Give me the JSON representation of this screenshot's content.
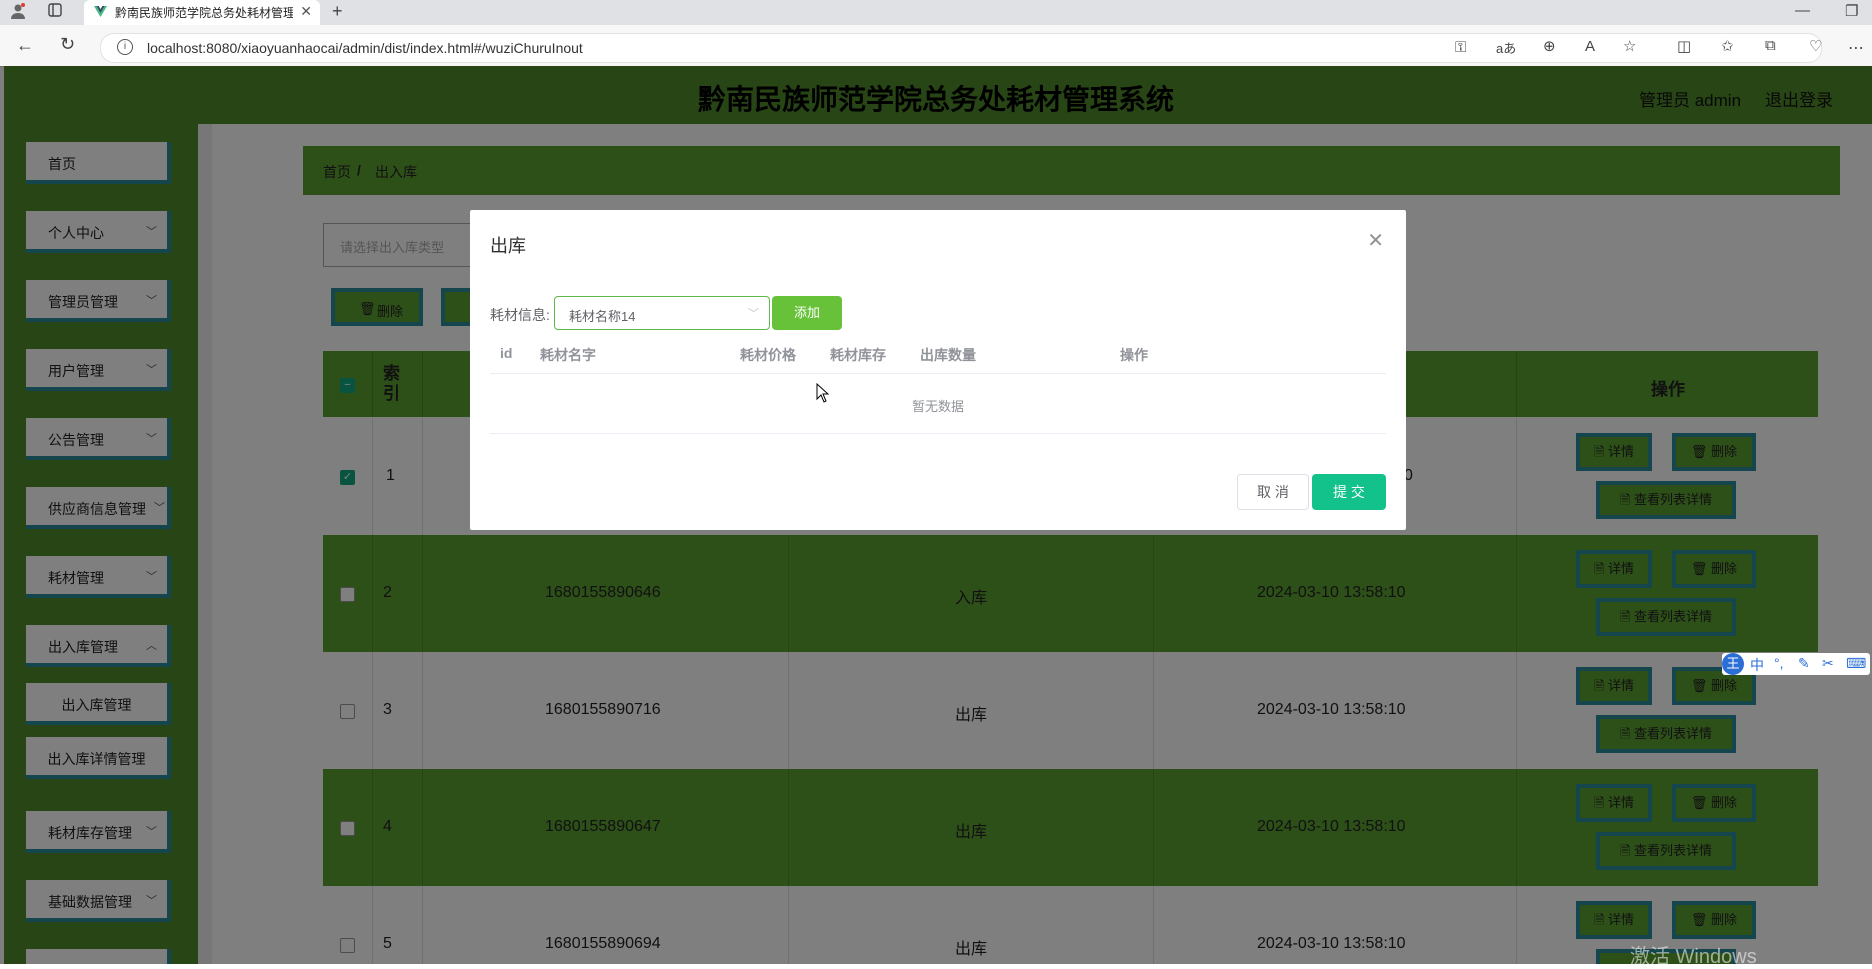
{
  "browser": {
    "tab_title": "黔南民族师范学院总务处耗材管理",
    "url": "localhost:8080/xiaoyuanhaocai/admin/dist/index.html#/wuziChuruInout"
  },
  "header": {
    "title": "黔南民族师范学院总务处耗材管理系统",
    "user": "管理员 admin",
    "logout": "退出登录"
  },
  "sidebar": {
    "items": [
      "首页",
      "个人中心",
      "管理员管理",
      "用户管理",
      "公告管理",
      "供应商信息管理",
      "耗材管理",
      "出入库管理",
      "耗材库存管理",
      "基础数据管理"
    ],
    "submenu": [
      "出入库管理",
      "出入库详情管理"
    ]
  },
  "breadcrumb": {
    "home": "首页",
    "sep": "/",
    "current": "出入库"
  },
  "toolbar": {
    "search_placeholder": "请选择出入库类型",
    "delete": "删除"
  },
  "table": {
    "headers": {
      "index": "索引",
      "actions": "操作"
    },
    "rows": [
      {
        "index": "1",
        "code": "",
        "type": "",
        "time": "0",
        "checked": true
      },
      {
        "index": "2",
        "code": "1680155890646",
        "type": "入库",
        "time": "2024-03-10 13:58:10",
        "checked": false
      },
      {
        "index": "3",
        "code": "1680155890716",
        "type": "出库",
        "time": "2024-03-10 13:58:10",
        "checked": false
      },
      {
        "index": "4",
        "code": "1680155890647",
        "type": "出库",
        "time": "2024-03-10 13:58:10",
        "checked": false
      },
      {
        "index": "5",
        "code": "1680155890694",
        "type": "出库",
        "time": "2024-03-10 13:58:10",
        "checked": false
      }
    ],
    "actions": {
      "detail": "详情",
      "delete": "删除",
      "list_detail": "查看列表详情"
    }
  },
  "dialog": {
    "title": "出库",
    "label": "耗材信息:",
    "selected": "耗材名称14",
    "add": "添加",
    "columns": [
      "id",
      "耗材名字",
      "耗材价格",
      "耗材库存",
      "出库数量",
      "操作"
    ],
    "empty": "暂无数据",
    "cancel": "取 消",
    "submit": "提 交"
  },
  "ime": {
    "label": "中"
  },
  "watermark": "激活 Windows",
  "colors": {
    "brand_green": "#5b9e31",
    "header_green": "#4f8a2b",
    "teal_border": "#2a8c9c",
    "submit": "#13c28a"
  }
}
